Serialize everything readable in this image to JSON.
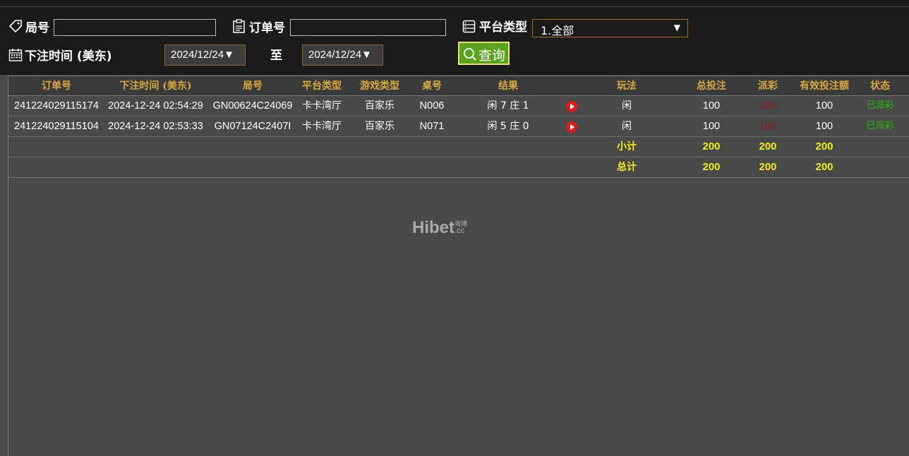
{
  "filters": {
    "round_label": "局号",
    "order_label": "订单号",
    "platform_label": "平台类型",
    "platform_value": "1.全部",
    "time_label": "下注时间 (美东)",
    "date_from": "2024/12/24▼",
    "to_label": "至",
    "date_to": "2024/12/24▼",
    "query_label": "查询",
    "round_value": "",
    "order_value": ""
  },
  "table": {
    "headers": [
      "订单号",
      "下注时间 (美东)",
      "局号",
      "平台类型",
      "游戏类型",
      "桌号",
      "结果",
      "",
      "玩法",
      "总投注",
      "派彩",
      "有效投注额",
      "状态"
    ],
    "rows": [
      {
        "order": "241224029115174",
        "time": "2024-12-24 02:54:29",
        "round": "GN00624C24069",
        "platform": "卡卡湾厅",
        "game": "百家乐",
        "table": "N006",
        "result": "闲 7 庄 1",
        "play": "闲",
        "total": "100",
        "payout": "100",
        "valid": "100",
        "status": "已派彩"
      },
      {
        "order": "241224029115104",
        "time": "2024-12-24 02:53:33",
        "round": "GN07124C2407I",
        "platform": "卡卡湾厅",
        "game": "百家乐",
        "table": "N071",
        "result": "闲 5 庄 0",
        "play": "闲",
        "total": "100",
        "payout": "100",
        "valid": "100",
        "status": "已派彩"
      }
    ],
    "subtotal": {
      "label": "小计",
      "total": "200",
      "payout": "200",
      "valid": "200"
    },
    "grandtotal": {
      "label": "总计",
      "total": "200",
      "payout": "200",
      "valid": "200"
    }
  },
  "colors": {
    "header_text": "#d8a840",
    "totals_text": "#f2ee1a",
    "status_paid": "#22c00a",
    "payout_text": "#8b1a1a",
    "query_button": "#5aa31e"
  },
  "watermark": {
    "brand": "Hibet",
    "suffix": ".cc",
    "cn": "海博"
  }
}
